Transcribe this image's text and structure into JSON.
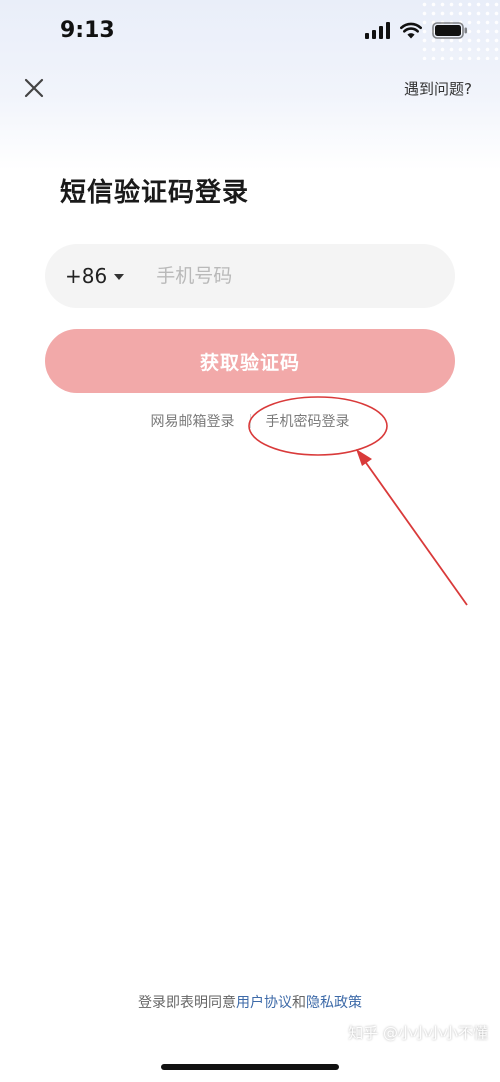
{
  "status_bar": {
    "time": "9:13",
    "icons": [
      "cellular-signal-icon",
      "wifi-icon",
      "battery-icon"
    ]
  },
  "nav": {
    "close_icon": "close-icon",
    "help_label": "遇到问题?"
  },
  "page": {
    "title": "短信验证码登录"
  },
  "phone": {
    "country_code": "+86",
    "placeholder": "手机号码",
    "value": ""
  },
  "get_code_button": {
    "label": "获取验证码",
    "color": "#f2a9a9"
  },
  "alt_logins": {
    "email_login": "网易邮箱登录",
    "password_login": "手机密码登录"
  },
  "agreement": {
    "prefix": "登录即表明同意",
    "user_agreement": "用户协议",
    "conjunction": "和",
    "privacy_policy": "隐私政策",
    "link_color": "#3d6aa8"
  },
  "annotation": {
    "color": "#d93a3a"
  },
  "watermark": {
    "text": "知乎 @小小小小不懂"
  }
}
